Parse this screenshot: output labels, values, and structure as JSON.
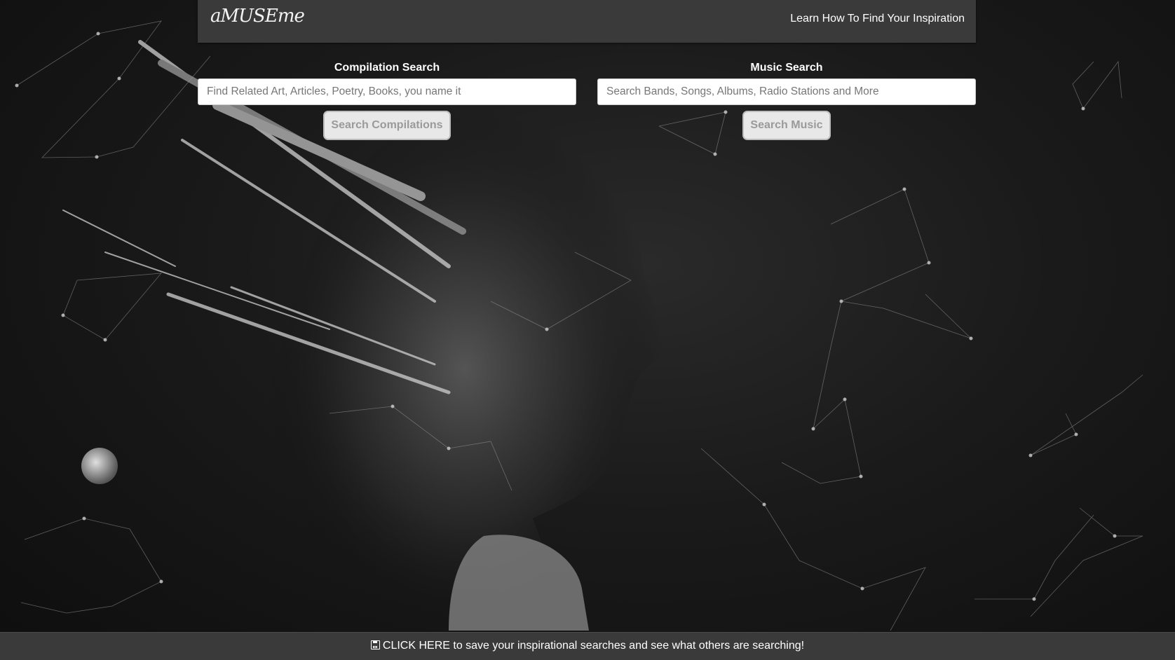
{
  "navbar": {
    "brand": "aMUSEme",
    "link_label": "Learn How To Find Your Inspiration"
  },
  "compilation_search": {
    "title": "Compilation Search",
    "placeholder": "Find Related Art, Articles, Poetry, Books, you name it",
    "button_label": "Search Compilations"
  },
  "music_search": {
    "title": "Music Search",
    "placeholder": "Search Bands, Songs, Albums, Radio Stations and More",
    "button_label": "Search Music"
  },
  "footer": {
    "icon": "floppy-disk-icon",
    "cta_highlight": "CLICK HERE",
    "cta_text": " to save your inspirational searches and see what others are searching!"
  },
  "theme": {
    "navbar_bg": "#3a3a3a",
    "footer_bg": "#3a3a3a",
    "button_bg": "#e8e8e8",
    "button_text": "#9a9a9a"
  }
}
